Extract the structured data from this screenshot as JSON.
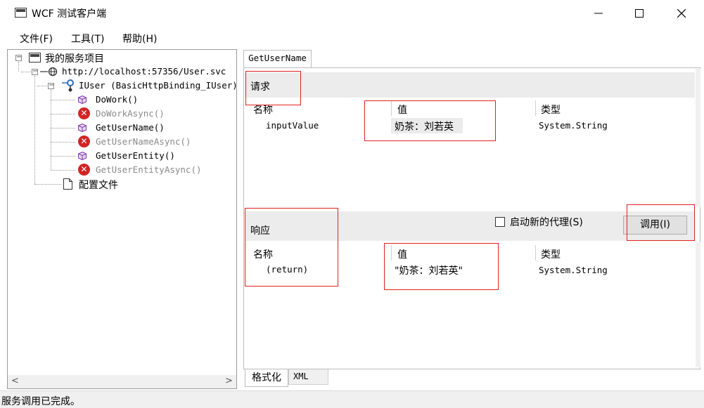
{
  "window": {
    "title": "WCF 测试客户端",
    "icon_text": "C:\\",
    "minimize": "—",
    "maximize": "☐",
    "close": "✕"
  },
  "menu": {
    "file": "文件(F)",
    "tools": "工具(T)",
    "help": "帮助(H)"
  },
  "tree": {
    "root": "我的服务项目",
    "endpoint": "http://localhost:57356/User.svc",
    "contract": "IUser (BasicHttpBinding_IUser)",
    "operations": [
      {
        "label": "DoWork()",
        "enabled": true
      },
      {
        "label": "DoWorkAsync()",
        "enabled": false
      },
      {
        "label": "GetUserName()",
        "enabled": true
      },
      {
        "label": "GetUserNameAsync()",
        "enabled": false
      },
      {
        "label": "GetUserEntity()",
        "enabled": true
      },
      {
        "label": "GetUserEntityAsync()",
        "enabled": false
      }
    ],
    "config": "配置文件",
    "scroll_left": "<",
    "scroll_right": ">"
  },
  "tabs": {
    "active": "GetUserName"
  },
  "request": {
    "section_title": "请求",
    "col_name": "名称",
    "col_value": "值",
    "col_type": "类型",
    "row": {
      "name": "inputValue",
      "value": "奶茶：刘若英",
      "type": "System.String"
    }
  },
  "response": {
    "section_title": "响应",
    "new_proxy_label": "启动新的代理(S)",
    "new_proxy_checked": false,
    "invoke_button": "调用(I)",
    "col_name": "名称",
    "col_value": "值",
    "col_type": "类型",
    "row": {
      "name": "(return)",
      "value": "\"奶茶：刘若英\"",
      "type": "System.String"
    }
  },
  "bottom_tabs": {
    "format": "格式化",
    "xml": "XML"
  },
  "status": {
    "text": "服务调用已完成。"
  },
  "colors": {
    "annotation_red": "#e02020",
    "error_icon": "#d32424",
    "section_bar": "#ececec",
    "button_face": "#e1e1e1"
  }
}
